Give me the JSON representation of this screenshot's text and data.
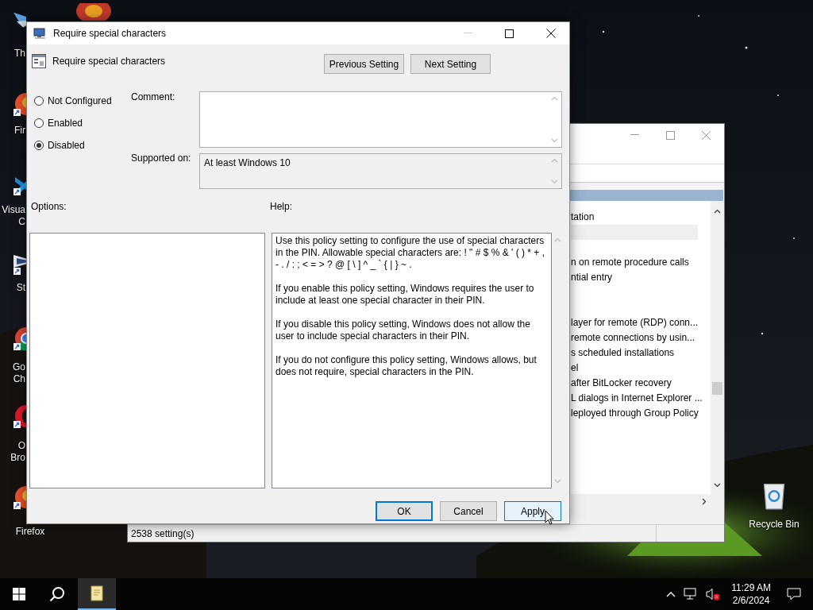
{
  "desktop": {
    "icons": [
      {
        "kind": "bird",
        "label": [
          "Th"
        ]
      },
      {
        "kind": "orb"
      },
      {
        "kind": "flame",
        "label": [
          "Fir"
        ]
      },
      {
        "kind": "ribbon",
        "label": [
          "Visua",
          "C"
        ]
      },
      {
        "kind": "wing",
        "label": [
          "St"
        ]
      },
      {
        "kind": "wheel",
        "label": [
          "Go",
          "Ch"
        ]
      },
      {
        "kind": "ring",
        "label": [
          "O",
          "Bro"
        ]
      },
      {
        "kind": "flame",
        "label": [
          "Firefox"
        ]
      },
      {
        "kind": "bin",
        "label": [
          "Recycle Bin"
        ]
      }
    ]
  },
  "background_window": {
    "rows": [
      {
        "kind": "text",
        "text": "tation"
      },
      {
        "kind": "hover"
      },
      {
        "kind": "blank"
      },
      {
        "kind": "text",
        "text": "n on remote procedure calls"
      },
      {
        "kind": "text",
        "text": "ntial entry"
      },
      {
        "kind": "blank"
      },
      {
        "kind": "blank"
      },
      {
        "kind": "text",
        "text": "layer for remote (RDP) conn..."
      },
      {
        "kind": "text",
        "text": "remote connections by usin..."
      },
      {
        "kind": "text",
        "text": "s scheduled installations"
      },
      {
        "kind": "text",
        "text": "el"
      },
      {
        "kind": "text",
        "text": "after BitLocker recovery"
      },
      {
        "kind": "text",
        "text": "L dialogs in Internet Explorer ..."
      },
      {
        "kind": "text",
        "text": "leployed through Group Policy"
      }
    ],
    "status_bar": "2538 setting(s)"
  },
  "dialog": {
    "title": "Require special characters",
    "heading": "Require special characters",
    "nav_buttons": [
      "Previous Setting",
      "Next Setting"
    ],
    "radios": [
      {
        "label": "Not Configured",
        "selected": false
      },
      {
        "label": "Enabled",
        "selected": false
      },
      {
        "label": "Disabled",
        "selected": true
      }
    ],
    "comment_label": "Comment:",
    "supported_label": "Supported on:",
    "supported_value": "At least Windows 10",
    "options_label": "Options:",
    "help_label": "Help:",
    "help": [
      "Use this policy setting to configure the use of special characters in the PIN.  Allowable special characters are: ! \" # $ % & ' ( ) * + , - . / : ; < = > ? @ [ \\ ] ^ _ ` { | } ~ .",
      "If you enable this policy setting, Windows requires the user to include at least one special character in their PIN.",
      "If you disable this policy setting, Windows does not allow the user to include special characters in their PIN.",
      "If you do not configure this policy setting, Windows allows, but does not require, special characters in the PIN."
    ],
    "buttons": [
      {
        "label": "OK",
        "default": true,
        "hovered": false
      },
      {
        "label": "Cancel",
        "default": false,
        "hovered": false
      },
      {
        "label": "Apply",
        "default": false,
        "hovered": true
      }
    ]
  },
  "taskbar": {
    "time": "11:29 AM",
    "date": "2/6/2024"
  }
}
